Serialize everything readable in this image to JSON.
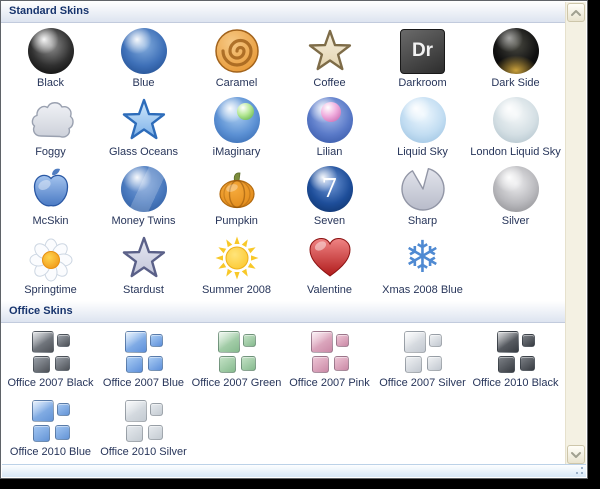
{
  "groups": [
    {
      "title": "Standard Skins",
      "items": [
        {
          "label": "Black",
          "icon": "sphere-icon",
          "c": [
            "#909090",
            "#303030",
            "#000000"
          ]
        },
        {
          "label": "Blue",
          "icon": "sphere-icon",
          "c": [
            "#85aede",
            "#3e70b8",
            "#1a4484"
          ]
        },
        {
          "label": "Caramel",
          "icon": "swirl-icon",
          "c": [
            "#f6c986",
            "#e89a38"
          ],
          "stroke": "#a2631c"
        },
        {
          "label": "Coffee",
          "icon": "star-icon",
          "c": [
            "#f7f0e0",
            "#e3d3ae"
          ],
          "stroke": "#7e6c48"
        },
        {
          "label": "Darkroom",
          "icon": "dr-square-icon",
          "c": [
            "#6a6a6a",
            "#2d2d2d"
          ],
          "text": "Dr"
        },
        {
          "label": "Dark Side",
          "icon": "sphere-glow-icon",
          "c": [
            "#4a4a42",
            "#101010",
            "#caa13c"
          ]
        },
        {
          "label": "Foggy",
          "icon": "cloud-icon",
          "c": [
            "#f0f2f6",
            "#cdd1da"
          ],
          "stroke": "#9aa1b0"
        },
        {
          "label": "Glass Oceans",
          "icon": "star-icon",
          "c": [
            "#d3eafc",
            "#7cb0e8"
          ],
          "stroke": "#2d6cba"
        },
        {
          "label": "iMaginary",
          "icon": "sphere-ball-icon",
          "c": [
            "#aacdf0",
            "#5c91d4",
            "#2d60a8"
          ],
          "ball": [
            "#b6e896",
            "#4ea83e"
          ],
          "ballPos": [
            23,
            6,
            17
          ]
        },
        {
          "label": "Lilian",
          "icon": "sphere-ball-icon",
          "c": [
            "#a9bcec",
            "#5a7ac8",
            "#2e4f9e"
          ],
          "ball": [
            "#f0aede",
            "#bf5aa6"
          ],
          "ballPos": [
            14,
            5,
            20
          ]
        },
        {
          "label": "Liquid Sky",
          "icon": "sphere-icon",
          "c": [
            "#eff8fe",
            "#c2ddf2",
            "#93bcdd"
          ]
        },
        {
          "label": "London Liquid Sky",
          "icon": "sphere-icon",
          "c": [
            "#f5f8f9",
            "#d4dfe4",
            "#a9bcc6"
          ]
        },
        {
          "label": "McSkin",
          "icon": "apple-icon",
          "c": [
            "#a3c3ee",
            "#4a7ac4"
          ],
          "stroke": "#2a58a4"
        },
        {
          "label": "Money Twins",
          "icon": "sphere-icon",
          "c": [
            "#7da3da",
            "#4878bd",
            "#2a5697"
          ],
          "band": true
        },
        {
          "label": "Pumpkin",
          "icon": "pumpkin-icon",
          "c": [
            "#f6ab3c",
            "#e08818"
          ],
          "stroke": "#b26a10",
          "stem": "#7c8c3c"
        },
        {
          "label": "Seven",
          "icon": "sphere-text-icon",
          "c": [
            "#6f97d6",
            "#1e4e9a",
            "#0a2b5e"
          ],
          "text": "7"
        },
        {
          "label": "Sharp",
          "icon": "pacman-icon",
          "c": [
            "#e2e4ec",
            "#b9bcca"
          ],
          "stroke": "#9296a6"
        },
        {
          "label": "Silver",
          "icon": "sphere-icon",
          "c": [
            "#ececee",
            "#b9b9bd",
            "#848488"
          ]
        },
        {
          "label": "Springtime",
          "icon": "daisy-icon",
          "c": [
            "#fbfcfe",
            "#ccd6e2"
          ],
          "center": [
            "#ffd44e",
            "#ef9718"
          ]
        },
        {
          "label": "Stardust",
          "icon": "star-icon",
          "c": [
            "#e6e8f2",
            "#c3c6da"
          ],
          "stroke": "#5a6088"
        },
        {
          "label": "Summer 2008",
          "icon": "sun-icon",
          "c": [
            "#ffe47a",
            "#fcc830"
          ],
          "ray": "#f8c828"
        },
        {
          "label": "Valentine",
          "icon": "heart-icon",
          "c": [
            "#f08484",
            "#b01b1b"
          ],
          "stroke": "#8c1212"
        },
        {
          "label": "Xmas 2008 Blue",
          "icon": "snowflake-icon",
          "c": [
            "#4f8ad2"
          ],
          "glyph": "❄"
        }
      ]
    },
    {
      "title": "Office Skins",
      "items": [
        {
          "label": "Office 2007 Black",
          "icon": "squares-icon",
          "c": [
            "#9aa0a8",
            "#4e5258"
          ]
        },
        {
          "label": "Office 2007 Blue",
          "icon": "squares-icon",
          "c": [
            "#aacdf4",
            "#5e90da"
          ]
        },
        {
          "label": "Office 2007 Green",
          "icon": "squares-icon",
          "c": [
            "#c4e2c6",
            "#86ba8e"
          ]
        },
        {
          "label": "Office 2007 Pink",
          "icon": "squares-icon",
          "c": [
            "#eec6d6",
            "#ca89a6"
          ]
        },
        {
          "label": "Office 2007 Silver",
          "icon": "squares-icon",
          "c": [
            "#f0f2f4",
            "#c2c8d0"
          ]
        },
        {
          "label": "Office 2010 Black",
          "icon": "squares-icon",
          "c": [
            "#7c8086",
            "#383c42"
          ]
        },
        {
          "label": "Office 2010 Blue",
          "icon": "squares-icon",
          "c": [
            "#a2c6f2",
            "#6494d6"
          ]
        },
        {
          "label": "Office 2010 Silver",
          "icon": "squares-icon",
          "c": [
            "#e6eaee",
            "#c4cbd2"
          ]
        }
      ]
    }
  ],
  "colors": {
    "header_text": "#17346d",
    "label_text": "#27355a",
    "header_gradient_top": "#ffffff",
    "header_gradient_bottom": "#dde4f0",
    "scroll_track": "#f4f1e3",
    "statusbar_bottom": "#d7e8f7",
    "outside_background": "#000000"
  }
}
